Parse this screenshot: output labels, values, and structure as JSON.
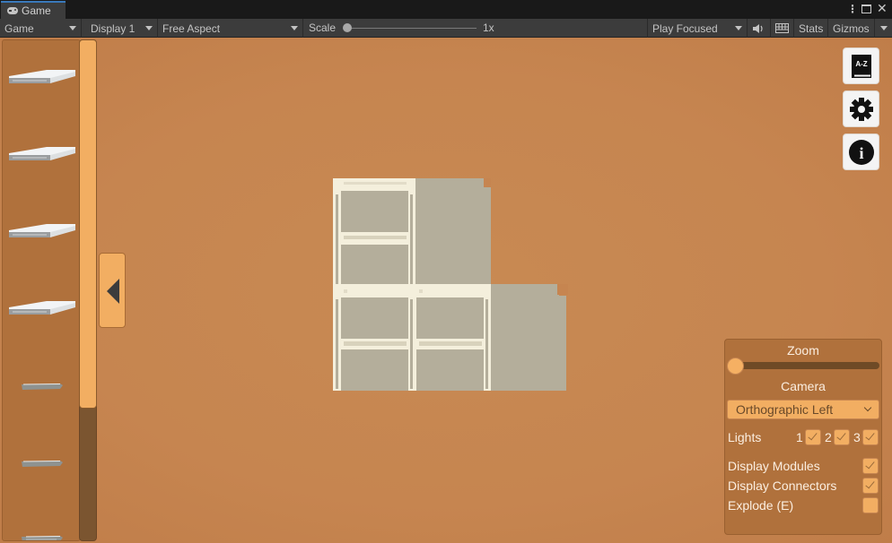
{
  "window": {
    "tab_label": "Game",
    "tab_icon": "gamepad-icon",
    "controls": [
      "more-options-icon",
      "maximize-icon",
      "close-icon"
    ]
  },
  "toolbar": {
    "view_select": "Game",
    "display_select": "Display 1",
    "aspect_select": "Free Aspect",
    "scale_label": "Scale",
    "scale_value": "1x",
    "play_mode_select": "Play Focused",
    "audio_icon": "speaker-icon",
    "keyboard_icon": "keyboard-icon",
    "stats_label": "Stats",
    "gizmos_label": "Gizmos"
  },
  "left_panel": {
    "modules": [
      {
        "type": "flat-panel"
      },
      {
        "type": "flat-panel"
      },
      {
        "type": "flat-panel"
      },
      {
        "type": "flat-panel"
      },
      {
        "type": "small-bar"
      },
      {
        "type": "small-bar"
      },
      {
        "type": "small-bar"
      }
    ],
    "scroll_fraction_visible": 0.73,
    "collapse_icon": "triangle-left-icon"
  },
  "right_buttons": [
    {
      "name": "glossary",
      "icon": "book-az-icon",
      "label": "A-Z"
    },
    {
      "name": "settings",
      "icon": "gear-icon"
    },
    {
      "name": "info",
      "icon": "info-icon",
      "label": "i"
    }
  ],
  "settings_panel": {
    "zoom_title": "Zoom",
    "zoom_value": 0.0,
    "camera_title": "Camera",
    "camera_selected": "Orthographic Left",
    "lights_label": "Lights",
    "lights": [
      {
        "label": "1",
        "checked": true
      },
      {
        "label": "2",
        "checked": true
      },
      {
        "label": "3",
        "checked": true
      }
    ],
    "toggles": [
      {
        "label": "Display Modules",
        "checked": true
      },
      {
        "label": "Display Connectors",
        "checked": true
      },
      {
        "label": "Explode (E)",
        "checked": false
      }
    ]
  },
  "colors": {
    "background": "#c68550",
    "panel": "#b0713c",
    "accent": "#f2ae62",
    "module_frame": "#f4efdc",
    "module_fill": "#b4ae9b"
  }
}
